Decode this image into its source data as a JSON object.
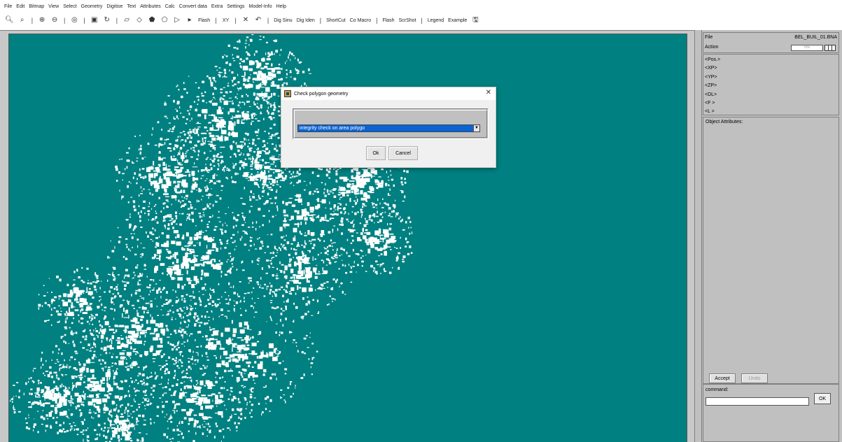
{
  "menu": [
    "File",
    "Edit",
    "Bitmap",
    "View",
    "Select",
    "Geometry",
    "Digitise",
    "Text",
    "Attributes",
    "Calc",
    "Convert data",
    "Extra",
    "Settings",
    "Model-Info",
    "Help"
  ],
  "toolbar": {
    "zoom_in_icon": "magnifier-icon",
    "flash1": "Flash",
    "xy": "XY",
    "dig_sinu": "Dig Sinu",
    "dig_iden": "Dig Iden",
    "shortcut": "ShortCut",
    "co_macro": "Co Macro",
    "flash2": "Flash",
    "scrshot": "ScrShot",
    "legend": "Legend",
    "example": "Example"
  },
  "panel": {
    "file_label": "File",
    "file_value": "BEL_BUIL_01.BNA",
    "action_label": "Action",
    "progress_pct": "0%",
    "progress_fraction": 0.0,
    "coords": [
      "<Pos.>",
      "<XP>",
      "<YP>",
      "<ZP>",
      "<DL>",
      "<F >",
      "<L >"
    ],
    "attributes_title": "Object Attributes:",
    "accept_label": "Accept",
    "undo_label": "Undo",
    "command_label": "command:",
    "command_value": "",
    "ok_label": "OK"
  },
  "dialog": {
    "title": "Check polygon geometry",
    "selected_option": "integrity check on area polygo",
    "ok_label": "Ok",
    "cancel_label": "Cancel"
  },
  "colors": {
    "map_background": "#008080",
    "selection": "#0a64d6",
    "progress_fill": "#ffff00"
  }
}
